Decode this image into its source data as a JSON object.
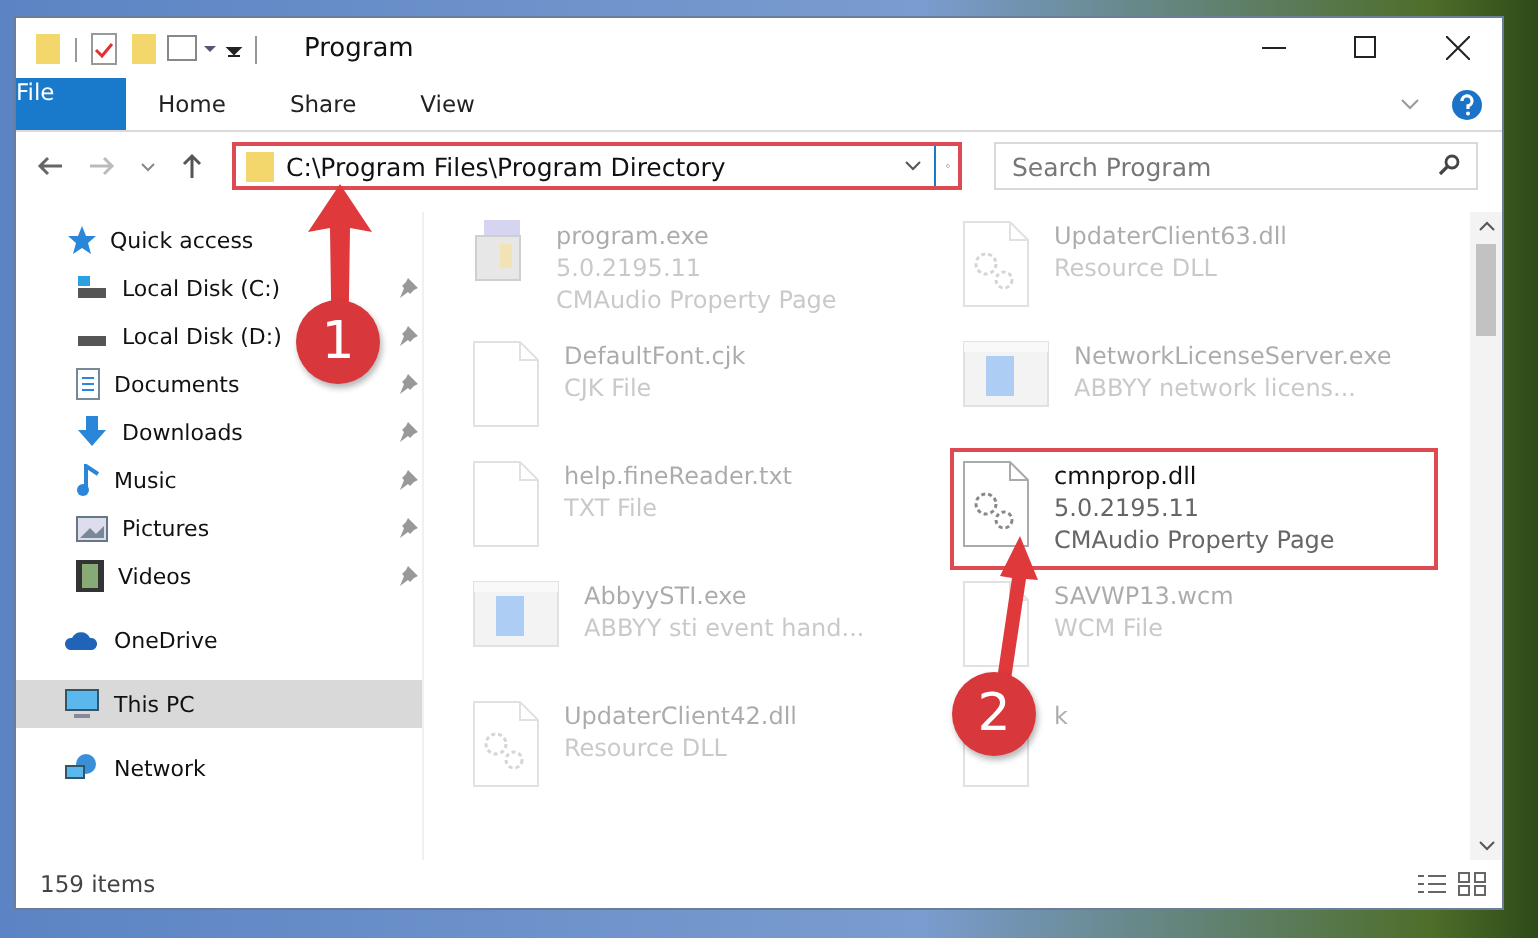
{
  "window": {
    "title": "Program"
  },
  "ribbon_tabs": [
    {
      "label": "File",
      "selected": true
    },
    {
      "label": "Home",
      "selected": false
    },
    {
      "label": "Share",
      "selected": false
    },
    {
      "label": "View",
      "selected": false
    }
  ],
  "address": {
    "path": "C:\\Program Files\\Program Directory"
  },
  "search": {
    "placeholder": "Search Program"
  },
  "sidebar": {
    "items": [
      {
        "label": "Quick access",
        "selected": false,
        "children": [
          {
            "label": "Local Disk (C:)",
            "selected": false,
            "pinned": true
          },
          {
            "label": "Local Disk (D:)",
            "selected": false,
            "pinned": true
          },
          {
            "label": "Documents",
            "selected": false,
            "pinned": true
          },
          {
            "label": "Downloads",
            "selected": false,
            "pinned": true
          },
          {
            "label": "Music",
            "selected": false,
            "pinned": true
          },
          {
            "label": "Pictures",
            "selected": false,
            "pinned": true
          },
          {
            "label": "Videos",
            "selected": false,
            "pinned": true
          }
        ]
      },
      {
        "label": "OneDrive",
        "selected": false
      },
      {
        "label": "This PC",
        "selected": true
      },
      {
        "label": "Network",
        "selected": false
      }
    ]
  },
  "files": [
    {
      "kind": "exe",
      "faded": true,
      "lines": [
        "program.exe",
        "5.0.2195.11",
        "CMAudio Property Page"
      ]
    },
    {
      "kind": "dll",
      "faded": true,
      "lines": [
        "UpdaterClient63.dll",
        "Resource DLL"
      ]
    },
    {
      "kind": "blank",
      "faded": true,
      "lines": [
        "DefaultFont.cjk",
        "CJK File"
      ]
    },
    {
      "kind": "app",
      "faded": true,
      "lines": [
        "NetworkLicenseServer.exe",
        "ABBYY network licens..."
      ]
    },
    {
      "kind": "blank",
      "faded": true,
      "lines": [
        "help.fineReader.txt",
        "TXT File"
      ]
    },
    {
      "kind": "dll",
      "faded": false,
      "lines": [
        "cmnprop.dll",
        "5.0.2195.11",
        "CMAudio Property Page"
      ]
    },
    {
      "kind": "app",
      "faded": true,
      "lines": [
        "AbbyySTI.exe",
        "ABBYY sti event hand..."
      ]
    },
    {
      "kind": "blank",
      "faded": true,
      "lines": [
        "SAVWP13.wcm",
        "WCM File"
      ]
    },
    {
      "kind": "dll",
      "faded": true,
      "lines": [
        "UpdaterClient42.dll",
        "Resource DLL"
      ]
    },
    {
      "kind": "blank",
      "faded": true,
      "lines": [
        "k"
      ]
    }
  ],
  "status_bar": {
    "count": "159 items"
  },
  "annotations": [
    {
      "label": "1"
    },
    {
      "label": "2"
    }
  ]
}
